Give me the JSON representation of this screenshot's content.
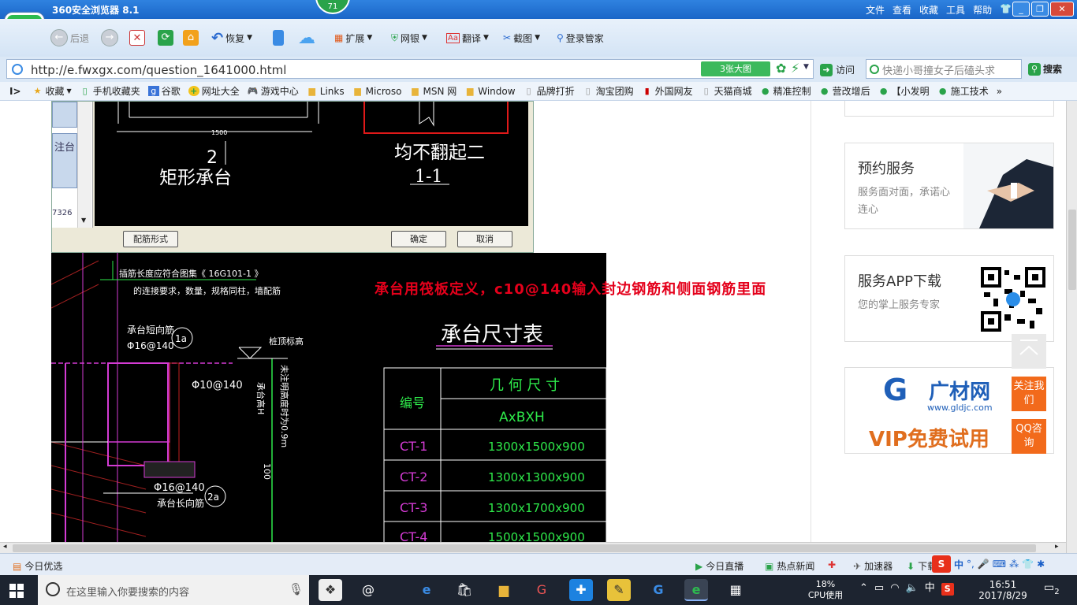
{
  "window": {
    "title": "360安全浏览器 8.1",
    "badge": "71",
    "menus": [
      "文件",
      "查看",
      "收藏",
      "工具",
      "帮助"
    ]
  },
  "toolbar": {
    "back": "后退",
    "restore": "恢复",
    "extend": "扩展",
    "bank": "网银",
    "translate": "翻译",
    "screenshot": "截图",
    "login": "登录管家"
  },
  "address": {
    "url": "http://e.fwxgx.com/question_1641000.html",
    "big_image": "3张大图",
    "visit": "访问",
    "search_placeholder": "快递小哥撞女子后磕头求",
    "search_button": "搜索"
  },
  "bookmarks": [
    {
      "label": "收藏",
      "icon": "star-icon"
    },
    {
      "label": "手机收藏夹",
      "icon": "phone-icon"
    },
    {
      "label": "谷歌",
      "icon": "g-icon"
    },
    {
      "label": "网址大全",
      "icon": "plus-icon"
    },
    {
      "label": "游戏中心",
      "icon": "gamepad-icon"
    },
    {
      "label": "Links",
      "icon": "folder-icon"
    },
    {
      "label": "Microso",
      "icon": "folder-icon"
    },
    {
      "label": "MSN 网",
      "icon": "folder-icon"
    },
    {
      "label": "Window",
      "icon": "folder-icon"
    },
    {
      "label": "品牌打折",
      "icon": "page-icon"
    },
    {
      "label": "淘宝团购",
      "icon": "page-icon"
    },
    {
      "label": "外国网友",
      "icon": "flag-icon"
    },
    {
      "label": "天猫商城",
      "icon": "page-icon"
    },
    {
      "label": "精准控制",
      "icon": "chat-icon"
    },
    {
      "label": "营改增后",
      "icon": "chat-icon"
    },
    {
      "label": "【小发明",
      "icon": "chat-icon"
    },
    {
      "label": "施工技术",
      "icon": "chat-icon"
    }
  ],
  "cad_dialog": {
    "side_tab_text": "注台",
    "side_number": "7326",
    "dim": "1500",
    "left_label_num": "2",
    "left_label": "矩形承台",
    "right_label": "均不翻起二",
    "right_section": "1-1",
    "btn_rebar": "配筋形式",
    "btn_ok": "确定",
    "btn_cancel": "取消"
  },
  "drawing": {
    "note1": "插筋长度应符合图集《    16G101-1    》",
    "note2": "的连接要求，数量，规格同柱，墙配筋",
    "short_rebar": "承台短向筋",
    "short_spec": "Φ16@140",
    "marker_1a": "1a",
    "stirrup": "Φ10@140",
    "pile_top": "桩顶标高",
    "height_label": "承台高H",
    "depth_label": "未注明高度时为0.9m",
    "long_spec": "Φ16@140",
    "long_rebar": "承台长向筋",
    "marker_2a": "2a",
    "dim_100": "100",
    "table_title": "承台尺寸表",
    "col_id": "编号",
    "col_geo": "几 何 尺 寸",
    "col_axb": "AxBXH",
    "rows": [
      {
        "id": "CT-1",
        "size": "1300x1500x900"
      },
      {
        "id": "CT-2",
        "size": "1300x1300x900"
      },
      {
        "id": "CT-3",
        "size": "1300x1700x900"
      },
      {
        "id": "CT-4",
        "size": "1500x1500x900"
      }
    ]
  },
  "annotation": "承台用筏板定义，c10@140输入封边钢筋和侧面钢筋里面",
  "side_cards": {
    "appointment_title": "预约服务",
    "appointment_sub": "服务面对面，承诺心连心",
    "app_title": "服务APP下载",
    "app_sub": "您的掌上服务专家",
    "ad_brand": "广材网",
    "ad_site": "www.gldjc.com",
    "ad_vip": "VIP免费试用"
  },
  "floating": {
    "follow": "关注我们",
    "qq": "QQ咨询"
  },
  "statusbar": {
    "today": "今日优选",
    "live": "今日直播",
    "hot": "热点新闻",
    "accelerator": "加速器",
    "download": "下载",
    "ime": "中"
  },
  "taskbar": {
    "search_placeholder": "在这里输入你要搜索的内容",
    "cpu_percent": "18%",
    "cpu_label": "CPU使用",
    "ime": "中",
    "time": "16:51",
    "date": "2017/8/29",
    "notify_count": "2"
  },
  "colors": {
    "titlebar": "#1a66c8",
    "annotation": "#e4001b",
    "cad_green": "#2ee94a",
    "cad_magenta": "#d43bd4",
    "float_orange": "#f26a1b"
  }
}
